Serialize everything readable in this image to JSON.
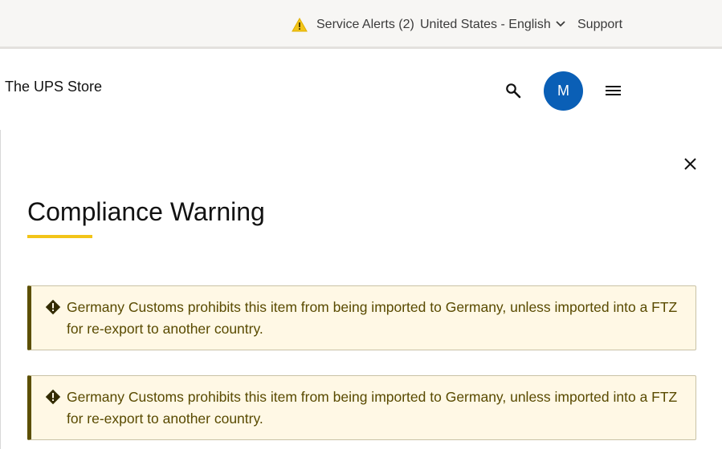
{
  "utility_bar": {
    "service_alerts": "Service Alerts (2)",
    "locale": "United States - English",
    "support": "Support",
    "alert_icon": "warning-triangle-icon",
    "alert_color": "#f2c418"
  },
  "header": {
    "brand": "The UPS Store",
    "avatar_initial": "M",
    "avatar_color": "#0a5fb6"
  },
  "modal": {
    "title": "Compliance Warning",
    "accent_color": "#f2c418",
    "warnings": [
      {
        "text": "Germany Customs prohibits this item from being imported to Germany, unless imported into a FTZ for re-export to another country."
      },
      {
        "text": "Germany Customs prohibits this item from being imported to Germany, unless imported into a FTZ for re-export to another country."
      }
    ]
  }
}
